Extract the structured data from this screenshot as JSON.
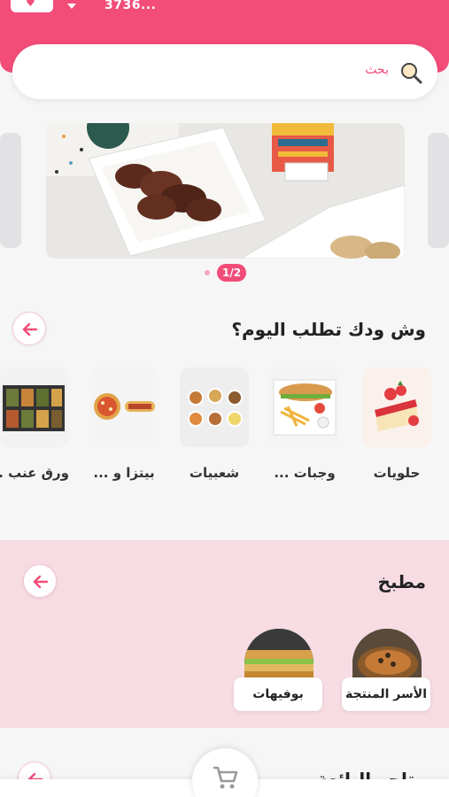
{
  "header": {
    "location_text": "3736...",
    "search_label": "بحث"
  },
  "banner": {
    "pager_text": "1/2"
  },
  "section_today": {
    "title": "وش ودك تطلب اليوم؟",
    "categories": [
      {
        "label": "حلويات"
      },
      {
        "label": "وجبات ..."
      },
      {
        "label": "شعبيات"
      },
      {
        "label": "بيتزا و ..."
      },
      {
        "label": "ورق عنب ..."
      }
    ]
  },
  "section_kitchen": {
    "title": "مطبخ",
    "cards": [
      {
        "label": "الأسر المنتجة"
      },
      {
        "label": "بوفيهات"
      }
    ]
  },
  "section_stores": {
    "title": "متاجر البائعة"
  },
  "colors": {
    "brand": "#f24c78",
    "kitchen_bg": "#f7dde3"
  }
}
